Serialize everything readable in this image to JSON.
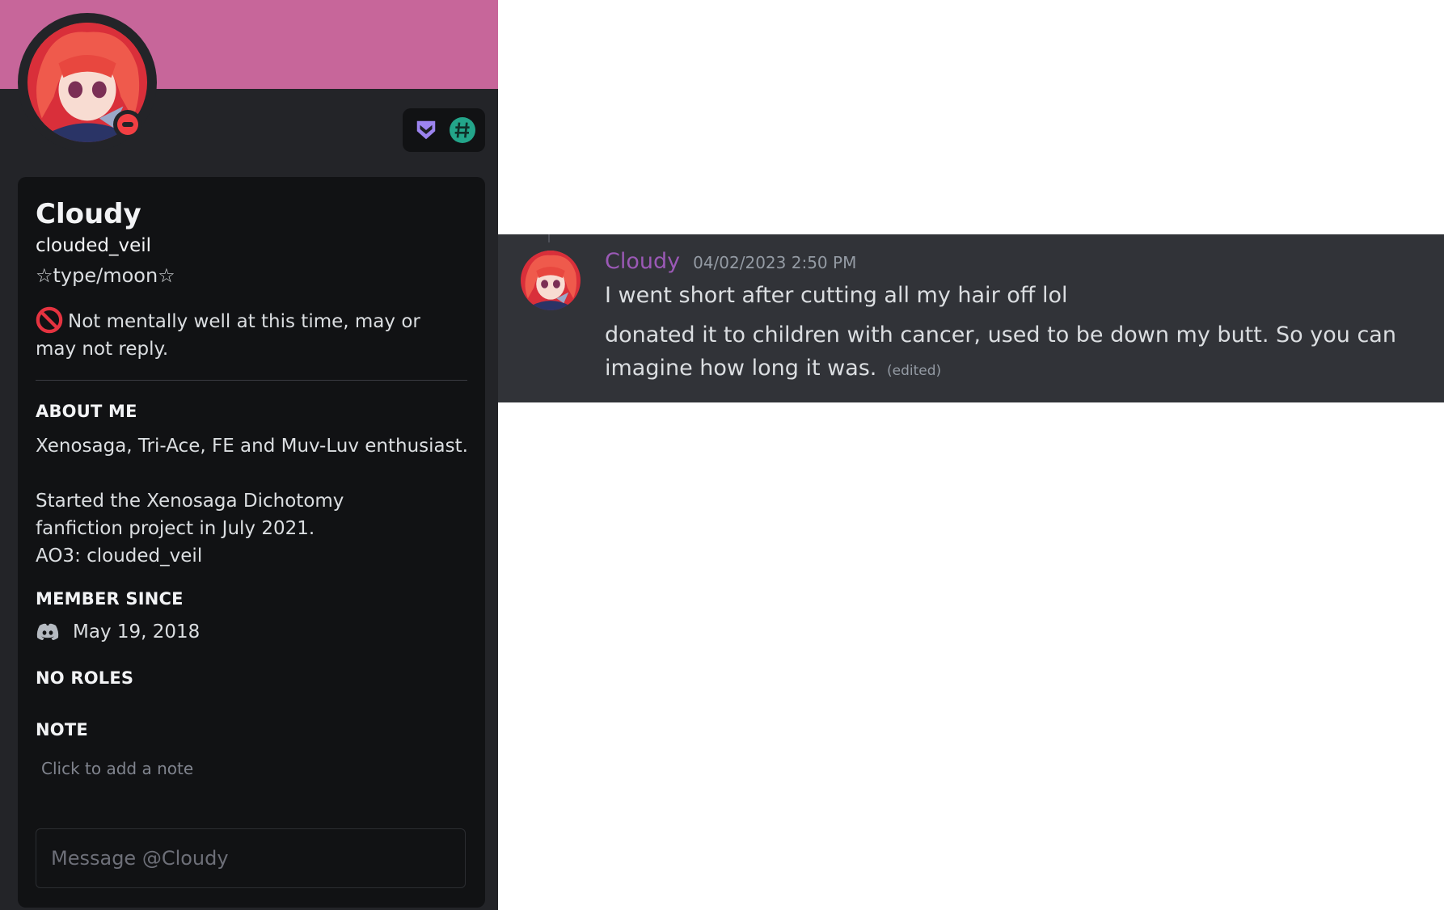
{
  "profile": {
    "display_name": "Cloudy",
    "username": "clouded_veil",
    "pronouns": "☆type/moon☆",
    "custom_status": "Not mentally well at this time, may or may not reply.",
    "status": "do-not-disturb",
    "banner_color": "#c7669a",
    "badges": [
      "hypesquad-bravery-icon",
      "hashtag-badge-icon"
    ],
    "about_me_title": "ABOUT ME",
    "about_me_text": "Xenosaga, Tri-Ace, FE and Muv-Luv enthusiast.\n\nStarted the Xenosaga Dichotomy\nfanfiction project in July 2021.\nAO3: clouded_veil",
    "member_since_title": "MEMBER SINCE",
    "member_since_date": "May 19, 2018",
    "roles_title": "NO ROLES",
    "note_title": "NOTE",
    "note_placeholder": "Click to add a note",
    "message_placeholder": "Message @Cloudy"
  },
  "chat": {
    "author": "Cloudy",
    "author_color": "#9b59b6",
    "timestamp": "04/02/2023 2:50 PM",
    "line1": "I went short after cutting all my hair off lol",
    "line2": "donated it to children with cancer, used to be down my butt. So you can imagine how long it was.",
    "edited_label": "(edited)"
  }
}
